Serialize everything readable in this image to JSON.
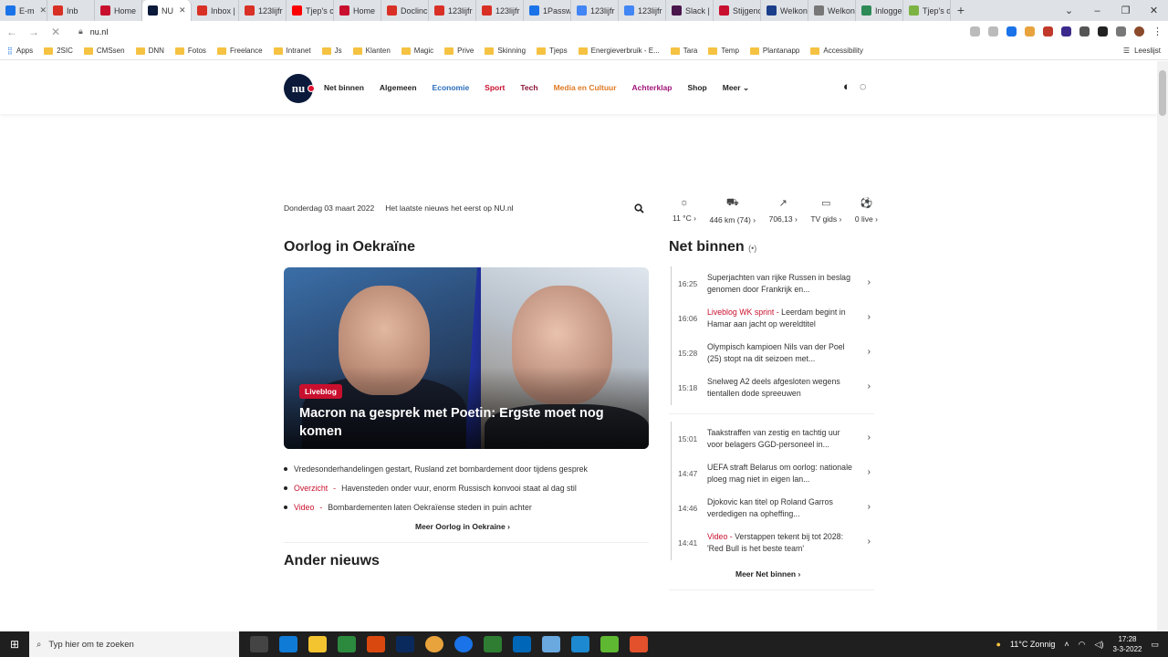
{
  "browser": {
    "tabs": [
      {
        "title": "E-m",
        "color": "#1a73e8"
      },
      {
        "title": "Inb",
        "color": "#d93025"
      },
      {
        "title": "Home",
        "color": "#c8102e"
      },
      {
        "title": "NU",
        "color": "#0b1a3a",
        "active": true
      },
      {
        "title": "Inbox |",
        "color": "#d93025"
      },
      {
        "title": "123lijfr",
        "color": "#d93025"
      },
      {
        "title": "Tjep's c",
        "color": "#ff0000"
      },
      {
        "title": "Home",
        "color": "#c8102e"
      },
      {
        "title": "Doclinc",
        "color": "#d93025"
      },
      {
        "title": "123lijfr",
        "color": "#d93025"
      },
      {
        "title": "123lijfr",
        "color": "#d93025"
      },
      {
        "title": "1Passw",
        "color": "#1a73e8"
      },
      {
        "title": "123lijfr",
        "color": "#4285f4"
      },
      {
        "title": "123lijfr",
        "color": "#4285f4"
      },
      {
        "title": "Slack |",
        "color": "#4a154b"
      },
      {
        "title": "Stijgenc",
        "color": "#c8102e"
      },
      {
        "title": "Welkon",
        "color": "#1a3e8a"
      },
      {
        "title": "Welkon",
        "color": "#777777"
      },
      {
        "title": "Inloggen",
        "color": "#2e8b57"
      },
      {
        "title": "Tjep's d",
        "color": "#7cb342"
      }
    ],
    "url": "nu.nl",
    "bookmarks": [
      "Apps",
      "2SIC",
      "CMSsen",
      "DNN",
      "Fotos",
      "Freelance",
      "Intranet",
      "Js",
      "Klanten",
      "Magic",
      "Prive",
      "Skinning",
      "Tjeps",
      "Energieverbruik - E...",
      "Tara",
      "Temp",
      "Plantanapp",
      "Accessibility"
    ],
    "reading_list": "Leeslijst"
  },
  "site": {
    "logo_text": "nu",
    "nav": [
      {
        "label": "Net binnen",
        "color": "#222222"
      },
      {
        "label": "Algemeen",
        "color": "#222222"
      },
      {
        "label": "Economie",
        "color": "#2a6ebb"
      },
      {
        "label": "Sport",
        "color": "#c8102e"
      },
      {
        "label": "Tech",
        "color": "#8a1538"
      },
      {
        "label": "Media en Cultuur",
        "color": "#e07b24"
      },
      {
        "label": "Achterklap",
        "color": "#a0157a"
      },
      {
        "label": "Shop",
        "color": "#222222"
      },
      {
        "label": "Meer",
        "color": "#222222"
      }
    ],
    "date": "Donderdag 03 maart 2022",
    "tagline": "Het laatste nieuws het eerst op NU.nl",
    "widgets": [
      {
        "icon": "sun-icon",
        "glyph": "☼",
        "label": "11 °C"
      },
      {
        "icon": "car-icon",
        "glyph": "⛟",
        "label": "446 km (74)"
      },
      {
        "icon": "chart-icon",
        "glyph": "↗",
        "label": "706,13"
      },
      {
        "icon": "tv-icon",
        "glyph": "▭",
        "label": "TV gids"
      },
      {
        "icon": "ball-icon",
        "glyph": "⚽",
        "label": "0 live"
      }
    ],
    "section1": {
      "title": "Oorlog in Oekraïne",
      "hero_badge": "Liveblog",
      "hero_title": "Macron na gesprek met Poetin: Ergste moet nog komen",
      "bullets": [
        {
          "label": "",
          "text": "Vredesonderhandelingen gestart, Rusland zet bombardement door tijdens gesprek"
        },
        {
          "label": "Overzicht",
          "text": "Havensteden onder vuur, enorm Russisch konvooi staat al dag stil"
        },
        {
          "label": "Video",
          "text": "Bombardementen laten Oekraïense steden in puin achter"
        }
      ],
      "more": "Meer Oorlog in Oekraine"
    },
    "section2": {
      "title": "Ander nieuws"
    },
    "net_binnen": {
      "title": "Net binnen",
      "items": [
        {
          "time": "16:25",
          "label": "",
          "text": "Superjachten van rijke Russen in beslag genomen door Frankrijk en..."
        },
        {
          "time": "16:06",
          "label": "Liveblog WK sprint",
          "text": "Leerdam begint in Hamar aan jacht op wereldtitel"
        },
        {
          "time": "15:28",
          "label": "",
          "text": "Olympisch kampioen Nils van der Poel (25) stopt na dit seizoen met..."
        },
        {
          "time": "15:18",
          "label": "",
          "text": "Snelweg A2 deels afgesloten wegens tientallen dode spreeuwen"
        },
        {
          "time": "15:01",
          "label": "",
          "text": "Taakstraffen van zestig en tachtig uur voor belagers GGD-personeel in..."
        },
        {
          "time": "14:47",
          "label": "",
          "text": "UEFA straft Belarus om oorlog: nationale ploeg mag niet in eigen lan..."
        },
        {
          "time": "14:46",
          "label": "",
          "text": "Djokovic kan titel op Roland Garros verdedigen na opheffing..."
        },
        {
          "time": "14:41",
          "label": "Video",
          "text": "Verstappen tekent bij tot 2028: 'Red Bull is het beste team'"
        }
      ],
      "more": "Meer Net binnen"
    }
  },
  "taskbar": {
    "search_placeholder": "Typ hier om te zoeken",
    "weather": "11°C  Zonnig",
    "time": "17:28",
    "date": "3-3-2022"
  }
}
